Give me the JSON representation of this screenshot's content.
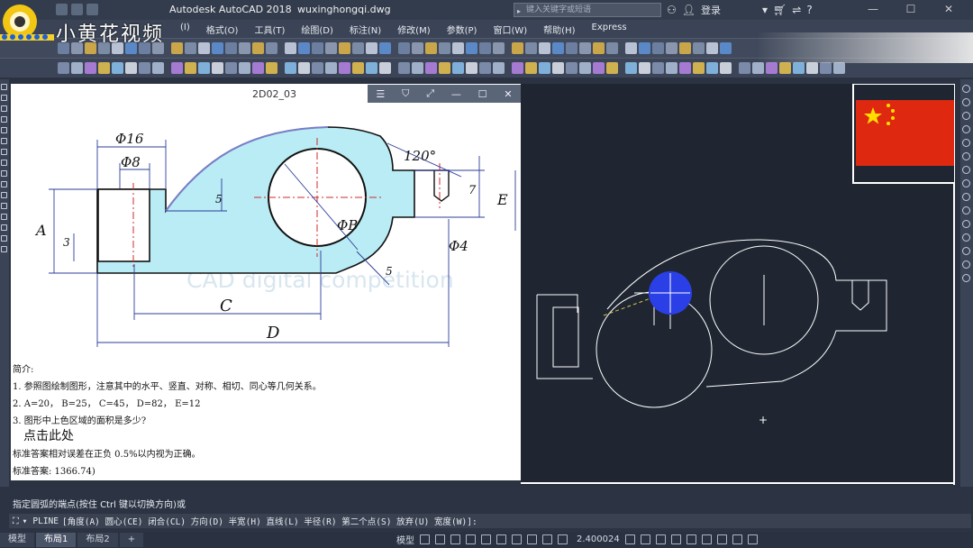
{
  "titlebar": {
    "app_title": "Autodesk AutoCAD 2018",
    "file_name": "wuxinghongqi.dwg",
    "search_placeholder": "键入关键字或短语",
    "login": "登录"
  },
  "watermark": "小黄花视频",
  "menu": [
    "(I)",
    "格式(O)",
    "工具(T)",
    "绘图(D)",
    "标注(N)",
    "修改(M)",
    "参数(P)",
    "窗口(W)",
    "帮助(H)",
    "Express"
  ],
  "viewer": {
    "title": "2D02_03"
  },
  "drawing": {
    "dims": {
      "phi16": "Φ16",
      "phi8": "Φ8",
      "five_top": "5",
      "a": "A",
      "three": "3",
      "angle": "120°",
      "seven": "7",
      "e": "E",
      "phiB": "ΦB",
      "phi4": "Φ4",
      "five_bottom": "5",
      "c": "C",
      "d": "D"
    },
    "bg_text": "CAD digital competition"
  },
  "problem": {
    "title": "简介:",
    "line1": "1. 参照图绘制图形，注意其中的水平、竖直、对称、相切、同心等几何关系。",
    "line2": "2. A=20， B=25， C=45， D=82， E=12",
    "line3": "3. 图形中上色区域的面积是多少?",
    "click": "点击此处",
    "line4": "标准答案相对误差在正负 0.5%以内视为正确。",
    "line5": "标准答案: 1366.74)"
  },
  "command": {
    "history": "指定圆弧的端点(按住 Ctrl 键以切换方向)或",
    "prompt_cmd": "PLINE",
    "options_text": "[角度(A) 圆心(CE) 闭合(CL) 方向(D) 半宽(H) 直线(L) 半径(R) 第二个点(S) 放弃(U) 宽度(W)]:"
  },
  "tabs": [
    "模型",
    "布局1",
    "布局2",
    "+"
  ],
  "status": {
    "model": "模型",
    "scale": "2.400024"
  },
  "colors": {
    "accent_fill": "#b9ecf4",
    "dim_blue": "#2c3d9a",
    "hatch_curve": "#7a7ec8",
    "flag_red": "#de2910",
    "flag_star": "#ffde00",
    "cursor_blue": "#2b3fe6",
    "cad_bg": "#1f2631"
  }
}
